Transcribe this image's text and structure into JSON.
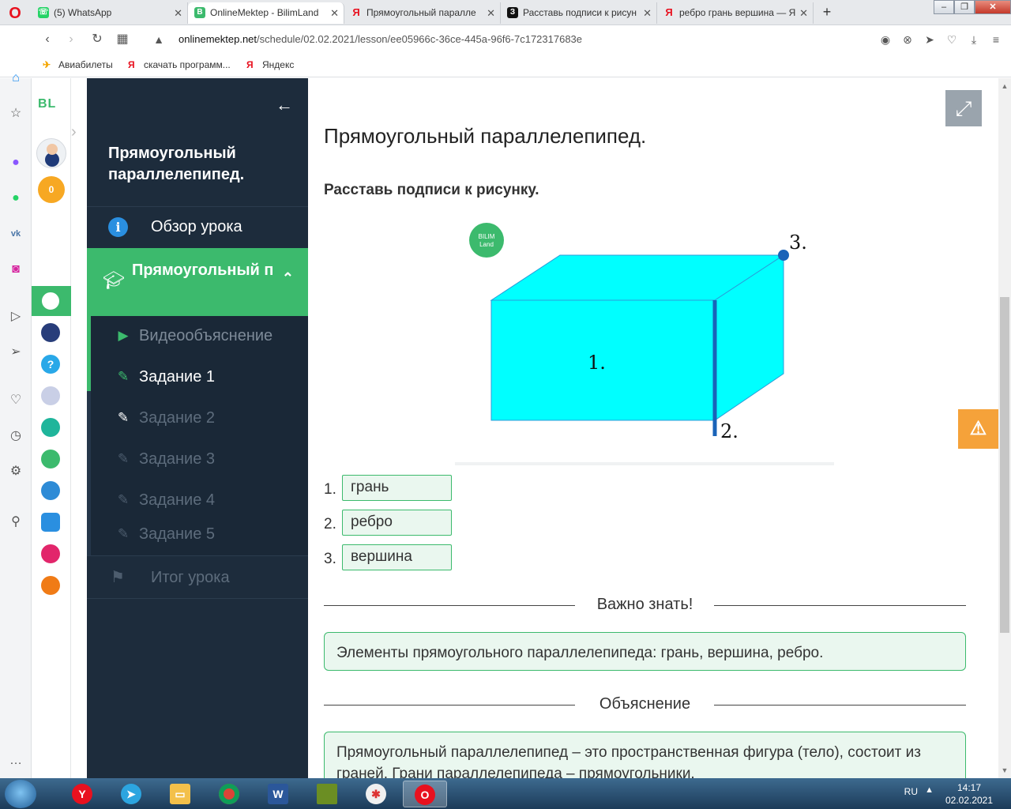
{
  "browser": {
    "tabs": [
      {
        "title": "(5) WhatsApp",
        "favicon": "whatsapp-icon",
        "color": "#25d366",
        "glyph": "☏"
      },
      {
        "title": "OnlineMektep - BilimLand",
        "favicon": "bilimland-icon",
        "color": "#3cba6d",
        "glyph": "B"
      },
      {
        "title": "Прямоугольный паралле",
        "favicon": "yandex-icon",
        "color": "#e8111f",
        "glyph": "Я"
      },
      {
        "title": "Расставь подписи к рисун",
        "favicon": "znanija-icon",
        "color": "#111111",
        "glyph": "З"
      },
      {
        "title": "ребро грань вершина — Я",
        "favicon": "yandex-icon",
        "color": "#e8111f",
        "glyph": "Я"
      }
    ],
    "url_domain": "onlinemektep.net",
    "url_path": "/schedule/02.02.2021/lesson/ee05966c-36ce-445a-96f6-7c172317683e",
    "bookmarks": [
      "Авиабилеты",
      "скачать программ...",
      "Яндекс"
    ]
  },
  "site": {
    "logo": "BL",
    "coins": "0"
  },
  "nav": {
    "title": "Прямоугольный параллелепипед.",
    "overview": "Обзор урока",
    "section": "Прямоугольный параллелепипед",
    "items": [
      {
        "label": "Видеообъяснение"
      },
      {
        "label": "Задание 1"
      },
      {
        "label": "Задание 2"
      },
      {
        "label": "Задание 3"
      },
      {
        "label": "Задание 4"
      },
      {
        "label": "Задание 5"
      }
    ],
    "summary": "Итог урока"
  },
  "main": {
    "lesson_title": "Прямоугольный параллелепипед.",
    "task_text": "Расставь подписи к рисунку.",
    "figure": {
      "logo_line1": "BILIM",
      "logo_line2": "Land",
      "label1": "1.",
      "label2": "2.",
      "label3": "3."
    },
    "answers": [
      {
        "num": "1.",
        "value": "грань"
      },
      {
        "num": "2.",
        "value": "ребро"
      },
      {
        "num": "3.",
        "value": "вершина"
      }
    ],
    "important_heading": "Важно знать!",
    "important_text": "Элементы прямоугольного параллелепипеда: грань, вершина, ребро.",
    "explanation_heading": "Объяснение",
    "explanation_text": "Прямоугольный параллелепипед – это пространственная фигура (тело), состоит из граней. Грани параллелепипеда – прямоугольники."
  },
  "taskbar": {
    "lang": "RU",
    "time": "14:17",
    "date": "02.02.2021"
  },
  "colors": {
    "accent": "#3cba6d",
    "nav_bg": "#1d2c3c",
    "box_face": "#00ffff",
    "edge": "#1a63b8"
  }
}
